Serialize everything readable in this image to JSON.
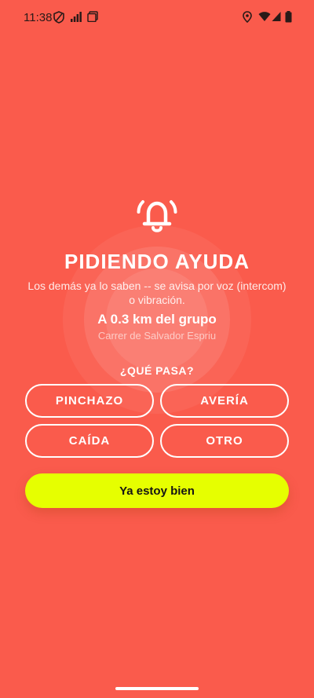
{
  "status_bar": {
    "time": "11:38"
  },
  "alert": {
    "title": "PIDIENDO AYUDA",
    "subtitle": "Los demás ya lo saben -- se avisa por voz (intercom) o vibración.",
    "distance": "A 0.3 km del grupo",
    "street": "Carrer de Salvador Espriu",
    "question": "¿QUÉ PASA?"
  },
  "options": [
    {
      "label": "PINCHAZO"
    },
    {
      "label": "AVERÍA"
    },
    {
      "label": "CAÍDA"
    },
    {
      "label": "OTRO"
    }
  ],
  "ok_button": {
    "label": "Ya estoy bien"
  },
  "colors": {
    "background": "#FA5B4C",
    "primary_button": "#E6FF00",
    "text": "#FFFFFF"
  },
  "icons": [
    "shield-icon",
    "signal-bars-icon",
    "screen-icon",
    "location-icon",
    "wifi-icon",
    "cell-signal-icon",
    "battery-icon",
    "bell-ringing-icon"
  ]
}
